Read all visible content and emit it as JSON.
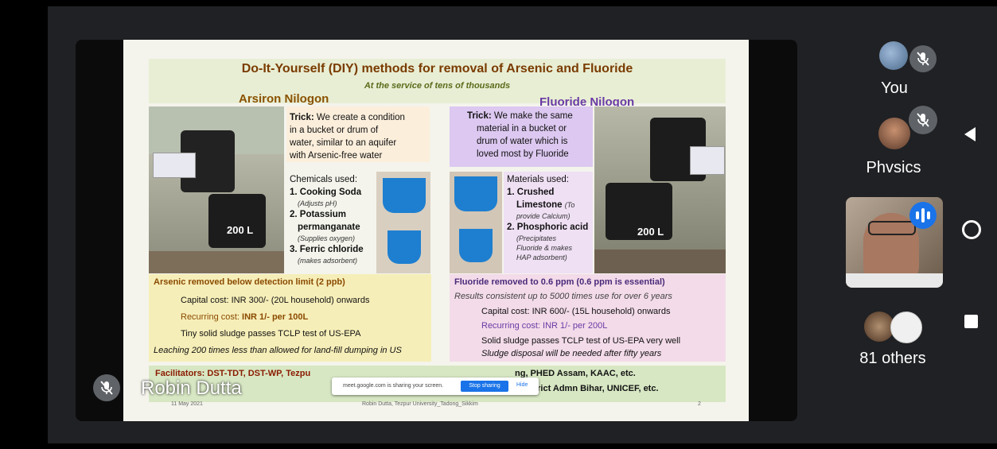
{
  "slide": {
    "title": "Do-It-Yourself (DIY) methods for removal of Arsenic and Fluoride",
    "subtitle": "At the service of tens of thousands",
    "arsiron": {
      "label": "Arsiron Nilogon",
      "tank_label": "200 L",
      "trick_head": "Trick:",
      "trick_lines": [
        "We create a condition",
        "in a bucket or drum of",
        "water, similar to an aquifer",
        "with Arsenic-free water"
      ],
      "chem_head": "Chemicals used:",
      "chem1": "1. Cooking Soda",
      "chem1_note": "(Adjusts pH)",
      "chem2a": "2. Potassium",
      "chem2b": "permanganate",
      "chem2_note": "(Supplies oxygen)",
      "chem3": "3. Ferric chloride",
      "chem3_note": "(makes adsorbent)",
      "result": "Arsenic removed below detection limit (2 ppb)",
      "capital": "Capital cost: INR 300/- (20L household) onwards",
      "recurring_lbl": "Recurring cost:",
      "recurring_val": "INR 1/- per 100L",
      "sludge": "Tiny solid sludge passes TCLP test of US-EPA",
      "leaching": "Leaching 200 times less than allowed for land-fill dumping in US"
    },
    "fluoride": {
      "label": "Fluoride Nilogon",
      "tank_label": "200 L",
      "trick_head": "Trick:",
      "trick_lines": [
        "We make the same",
        "material in a bucket or",
        "drum of water which is",
        "loved most by Fluoride"
      ],
      "mat_head": "Materials used:",
      "mat1a": "1. Crushed",
      "mat1b": "Limestone",
      "mat1_note_a": "(To",
      "mat1_note_b": "provide Calcium)",
      "mat2": "2. Phosphoric acid",
      "mat2_note_a": "(Precipitates",
      "mat2_note_b": "Fluoride & makes",
      "mat2_note_c": "HAP adsorbent)",
      "result": "Fluoride removed to 0.6 ppm (0.6 ppm is essential)",
      "consistent": "Results consistent up to 5000 times use for over 6 years",
      "capital": "Capital cost: INR 600/- (15L household) onwards",
      "recurring": "Recurring cost: INR 1/- per 200L",
      "sludge": "Solid sludge passes TCLP test of US-EPA very well",
      "disposal": "Sludge disposal will be needed after fifty years"
    },
    "facilitators_line1": "Facilitators: DST-TDT, DST-WP, Tezpu",
    "facilitators_line1_end": "ng, PHED Assam, KAAC, etc.",
    "facilitators_line2_end": "r District Admn Bihar, UNICEF, etc.",
    "footer_date": "11 May 2021",
    "footer_center": "Robin Dutta, Tezpur University_Tadong_Sikkim",
    "footer_page": "2"
  },
  "presenter_name": "Robin Dutta",
  "share_bar": {
    "text": "meet.google.com is sharing your screen.",
    "stop": "Stop sharing",
    "hide": "Hide"
  },
  "participants": {
    "you": "You",
    "second": "Phvsics",
    "others": "81 others"
  }
}
